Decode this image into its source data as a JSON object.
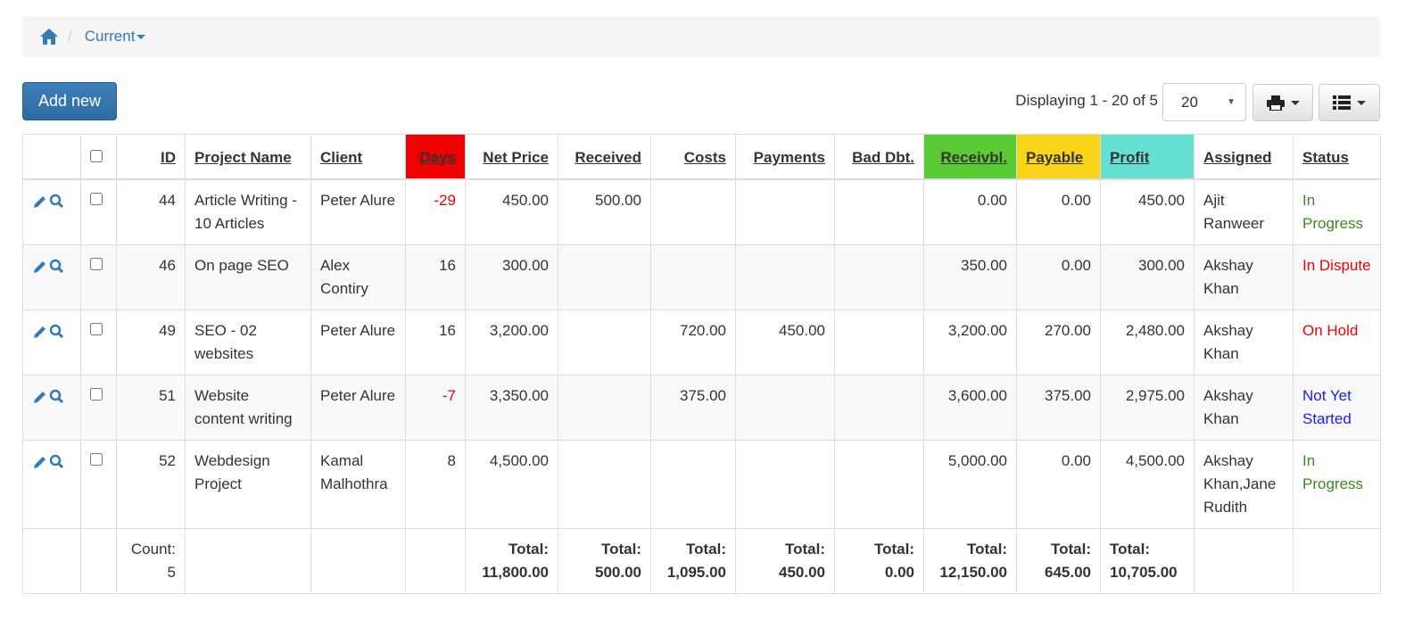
{
  "breadcrumb": {
    "current": "Current"
  },
  "toolbar": {
    "add_label": "Add new",
    "displaying": "Displaying 1 - 20 of 5",
    "page_size": "20"
  },
  "colors": {
    "days": "#f00000",
    "receivable": "#5bcb35",
    "payable": "#fad419",
    "profit": "#66e0d0",
    "link": "#337ab7"
  },
  "table": {
    "headers": {
      "id": "ID",
      "project": "Project Name",
      "client": "Client",
      "days": "Days",
      "net_price": "Net Price",
      "received": "Received",
      "costs": "Costs",
      "payments": "Payments",
      "bad_debt": "Bad Dbt.",
      "receivable": "Receivbl.",
      "payable": "Payable",
      "profit": "Profit",
      "assigned": "Assigned",
      "status": "Status"
    },
    "rows": [
      {
        "id": "44",
        "project": "Article Writing - 10 Articles",
        "client": "Peter Alure",
        "days": "-29",
        "days_color": "#f00000",
        "net_price": "450.00",
        "received": "500.00",
        "costs": "",
        "payments": "",
        "bad_debt": "",
        "receivable": "0.00",
        "payable": "0.00",
        "profit": "450.00",
        "assigned": "Ajit Ranweer",
        "status": "In Progress",
        "status_color": "#3c8a1e"
      },
      {
        "id": "46",
        "project": "On page SEO",
        "client": "Alex Contiry",
        "days": "16",
        "days_color": "#333",
        "net_price": "300.00",
        "received": "",
        "costs": "",
        "payments": "",
        "bad_debt": "",
        "receivable": "350.00",
        "payable": "0.00",
        "profit": "300.00",
        "assigned": "Akshay Khan",
        "status": "In Dispute",
        "status_color": "#f00000"
      },
      {
        "id": "49",
        "project": "SEO - 02 websites",
        "client": "Peter Alure",
        "days": "16",
        "days_color": "#333",
        "net_price": "3,200.00",
        "received": "",
        "costs": "720.00",
        "payments": "450.00",
        "bad_debt": "",
        "receivable": "3,200.00",
        "payable": "270.00",
        "profit": "2,480.00",
        "assigned": "Akshay Khan",
        "status": "On Hold",
        "status_color": "#f00000"
      },
      {
        "id": "51",
        "project": "Website content writing",
        "client": "Peter Alure",
        "days": "-7",
        "days_color": "#f00000",
        "net_price": "3,350.00",
        "received": "",
        "costs": "375.00",
        "payments": "",
        "bad_debt": "",
        "receivable": "3,600.00",
        "payable": "375.00",
        "profit": "2,975.00",
        "assigned": "Akshay Khan",
        "status": "Not Yet Started",
        "status_color": "#1a1aff"
      },
      {
        "id": "52",
        "project": "Webdesign Project",
        "client": "Kamal Malhothra",
        "days": "8",
        "days_color": "#333",
        "net_price": "4,500.00",
        "received": "",
        "costs": "",
        "payments": "",
        "bad_debt": "",
        "receivable": "5,000.00",
        "payable": "0.00",
        "profit": "4,500.00",
        "assigned": "Akshay Khan,Jane Rudith",
        "status": "In Progress",
        "status_color": "#3c8a1e"
      }
    ],
    "footer": {
      "count_label": "Count:",
      "count": "5",
      "total_label": "Total:",
      "net_price": "11,800.00",
      "received": "500.00",
      "costs": "1,095.00",
      "payments": "450.00",
      "bad_debt": "0.00",
      "receivable": "12,150.00",
      "payable": "645.00",
      "profit": "10,705.00"
    }
  }
}
